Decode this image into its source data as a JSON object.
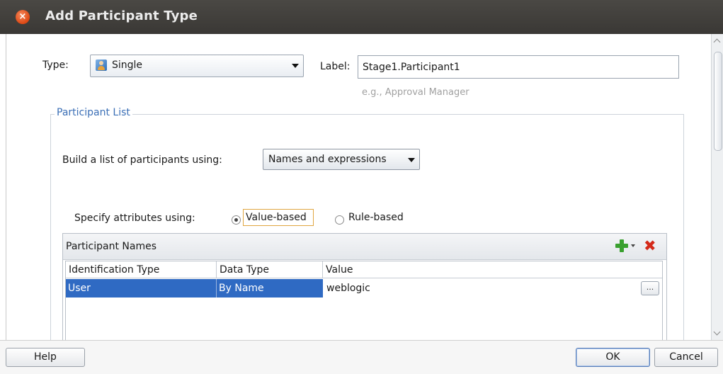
{
  "window": {
    "title": "Add Participant Type",
    "close_symbol": "×"
  },
  "type_field": {
    "label": "Type:",
    "value": "Single",
    "icon": "user-icon"
  },
  "label_field": {
    "label": "Label:",
    "value": "Stage1.Participant1",
    "hint": "e.g., Approval Manager"
  },
  "participant_list": {
    "legend": "Participant List",
    "build_label": "Build a list of participants using:",
    "build_value": "Names and expressions",
    "attributes_label": "Specify attributes using:",
    "radio_options": [
      {
        "label": "Value-based",
        "checked": true
      },
      {
        "label": "Rule-based",
        "checked": false
      }
    ],
    "table": {
      "title": "Participant Names",
      "columns": [
        "Identification Type",
        "Data Type",
        "Value"
      ],
      "rows": [
        {
          "identification_type": "User",
          "data_type": "By Name",
          "value": "weblogic"
        }
      ],
      "browse_label": "..."
    }
  },
  "footer": {
    "help": "Help",
    "ok": "OK",
    "cancel": "Cancel"
  },
  "colors": {
    "selection": "#2f6ac3",
    "legend": "#3b6fb6",
    "title_bar": "#3c3b37",
    "close": "#e05b2b"
  }
}
